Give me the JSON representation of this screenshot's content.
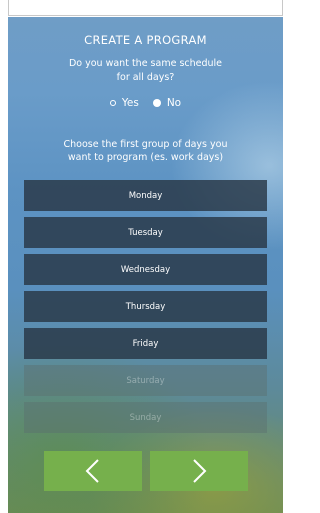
{
  "screen": {
    "title": "CREATE A PROGRAM",
    "question_line1": "Do you want the same schedule",
    "question_line2": "for all days?",
    "options": [
      {
        "label": "Yes",
        "selected": false
      },
      {
        "label": "No",
        "selected": true
      }
    ],
    "instruction_line1": "Choose the first group of days you",
    "instruction_line2": "want to program (es. work days)",
    "days": [
      {
        "label": "Monday",
        "enabled": true
      },
      {
        "label": "Tuesday",
        "enabled": true
      },
      {
        "label": "Wednesday",
        "enabled": true
      },
      {
        "label": "Thursday",
        "enabled": true
      },
      {
        "label": "Friday",
        "enabled": true
      },
      {
        "label": "Saturday",
        "enabled": false
      },
      {
        "label": "Sunday",
        "enabled": false
      }
    ],
    "nav": {
      "back_icon": "chevron-left-icon",
      "next_icon": "chevron-right-icon"
    }
  },
  "colors": {
    "accent": "#76b04c",
    "day_button": "#28374a",
    "text": "#ffffff"
  }
}
